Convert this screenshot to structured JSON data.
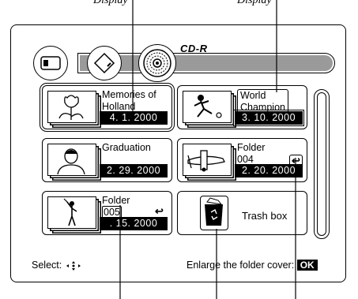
{
  "top_labels": {
    "left": "Display",
    "right": "Display"
  },
  "media_bar": {
    "label": "CD-R"
  },
  "tiles": [
    {
      "title_line1": "Memories of",
      "title_line2": "Holland",
      "date": "4. 1. 2000",
      "thumb": "tulip-thumbnail"
    },
    {
      "title_line1": "World",
      "title_line2": "Champion",
      "date": "3. 10. 2000",
      "thumb": "soccer-thumbnail"
    },
    {
      "title_line1": "Graduation",
      "title_line2": "",
      "date": "2. 29. 2000",
      "thumb": "portrait-thumbnail"
    },
    {
      "title_line1": "Folder",
      "title_line2": "004",
      "date": "2. 20. 2000",
      "thumb": "airplane-thumbnail"
    },
    {
      "title_line1": "Folder",
      "title_line2": "005",
      "date": ". 15. 2000",
      "thumb": "golfer-thumbnail"
    }
  ],
  "trash": {
    "label": "Trash box"
  },
  "footer": {
    "select_label": "Select:",
    "enlarge_label": "Enlarge the folder cover:",
    "ok_label": "OK"
  },
  "icons": {
    "return": "↩"
  }
}
